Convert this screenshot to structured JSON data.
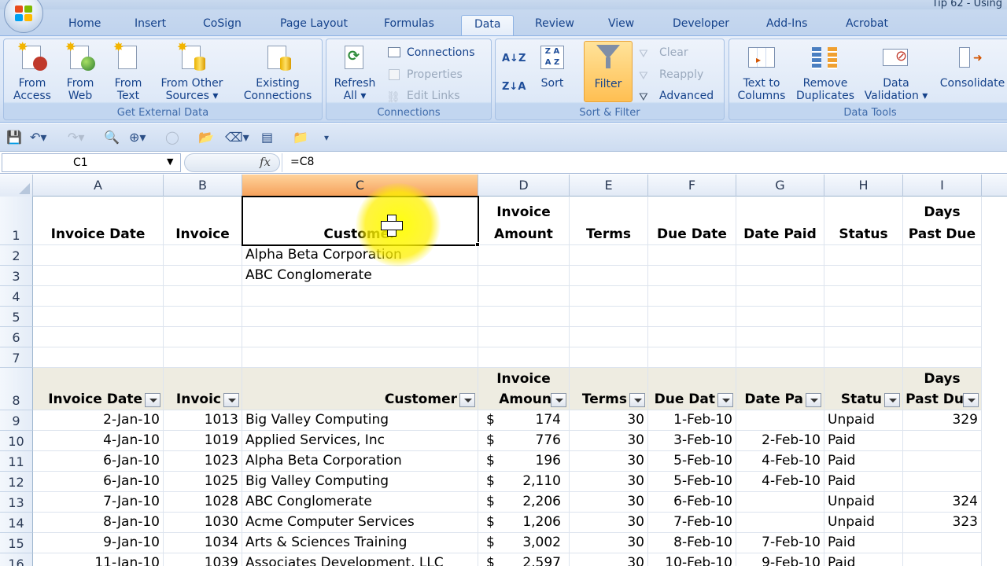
{
  "window": {
    "title": "Tip 62 - Using"
  },
  "ribbon_tabs": [
    "Home",
    "Insert",
    "CoSign",
    "Page Layout",
    "Formulas",
    "Data",
    "Review",
    "View",
    "Developer",
    "Add-Ins",
    "Acrobat"
  ],
  "active_tab": "Data",
  "groups": {
    "get_external": {
      "label": "Get External Data",
      "from_access": [
        "From",
        "Access"
      ],
      "from_web": [
        "From",
        "Web"
      ],
      "from_text": [
        "From",
        "Text"
      ],
      "from_other": [
        "From Other",
        "Sources ▾"
      ],
      "existing": [
        "Existing",
        "Connections"
      ]
    },
    "connections": {
      "label": "Connections",
      "refresh": [
        "Refresh",
        "All ▾"
      ],
      "connections": "Connections",
      "properties": "Properties",
      "edit_links": "Edit Links"
    },
    "sort_filter": {
      "label": "Sort & Filter",
      "sort": "Sort",
      "filter": "Filter",
      "clear": "Clear",
      "reapply": "Reapply",
      "advanced": "Advanced"
    },
    "data_tools": {
      "label": "Data Tools",
      "text_to_columns": [
        "Text to",
        "Columns"
      ],
      "remove_duplicates": [
        "Remove",
        "Duplicates"
      ],
      "data_validation": [
        "Data",
        "Validation ▾"
      ],
      "consolidate": "Consolidate"
    }
  },
  "formula_bar": {
    "name_box": "C1",
    "fx": "fx",
    "formula": "=C8"
  },
  "columns": [
    "A",
    "B",
    "C",
    "D",
    "E",
    "F",
    "G",
    "H",
    "I"
  ],
  "selected_column": "C",
  "rows": [
    "1",
    "2",
    "3",
    "4",
    "5",
    "6",
    "7",
    "8",
    "9",
    "10",
    "11",
    "12",
    "13",
    "14",
    "15",
    "16"
  ],
  "header_row1": {
    "A": "Invoice Date",
    "B": "Invoice",
    "C": "Customer",
    "D": [
      "Invoice",
      "Amount"
    ],
    "E": "Terms",
    "F": "Due Date",
    "G": "Date Paid",
    "H": "Status",
    "I": [
      "Days",
      "Past Due"
    ]
  },
  "criteria": [
    "Alpha Beta Corporation",
    "ABC Conglomerate"
  ],
  "header_row8": {
    "A": "Invoice Date",
    "B": "Invoic",
    "C": "Customer",
    "D": [
      "Invoice",
      "Amoun"
    ],
    "E": "Terms",
    "F": "Due Dat",
    "G": "Date Pa",
    "H": "Statu",
    "I": [
      "Days",
      "Past Du"
    ]
  },
  "table": [
    {
      "date": "2-Jan-10",
      "inv": "1013",
      "cust": "Big Valley Computing",
      "cur": "$",
      "amt": "174",
      "terms": "30",
      "due": "1-Feb-10",
      "paid": "",
      "status": "Unpaid",
      "days": "329"
    },
    {
      "date": "4-Jan-10",
      "inv": "1019",
      "cust": "Applied Services, Inc",
      "cur": "$",
      "amt": "776",
      "terms": "30",
      "due": "3-Feb-10",
      "paid": "2-Feb-10",
      "status": "Paid",
      "days": ""
    },
    {
      "date": "6-Jan-10",
      "inv": "1023",
      "cust": "Alpha Beta Corporation",
      "cur": "$",
      "amt": "196",
      "terms": "30",
      "due": "5-Feb-10",
      "paid": "4-Feb-10",
      "status": "Paid",
      "days": ""
    },
    {
      "date": "6-Jan-10",
      "inv": "1025",
      "cust": "Big Valley Computing",
      "cur": "$",
      "amt": "2,110",
      "terms": "30",
      "due": "5-Feb-10",
      "paid": "4-Feb-10",
      "status": "Paid",
      "days": ""
    },
    {
      "date": "7-Jan-10",
      "inv": "1028",
      "cust": "ABC Conglomerate",
      "cur": "$",
      "amt": "2,206",
      "terms": "30",
      "due": "6-Feb-10",
      "paid": "",
      "status": "Unpaid",
      "days": "324"
    },
    {
      "date": "8-Jan-10",
      "inv": "1030",
      "cust": "Acme Computer Services",
      "cur": "$",
      "amt": "1,206",
      "terms": "30",
      "due": "7-Feb-10",
      "paid": "",
      "status": "Unpaid",
      "days": "323"
    },
    {
      "date": "9-Jan-10",
      "inv": "1034",
      "cust": "Arts & Sciences Training",
      "cur": "$",
      "amt": "3,002",
      "terms": "30",
      "due": "8-Feb-10",
      "paid": "7-Feb-10",
      "status": "Paid",
      "days": ""
    },
    {
      "date": "11-Jan-10",
      "inv": "1039",
      "cust": "Associates Development, LLC",
      "cur": "$",
      "amt": "2,597",
      "terms": "30",
      "due": "10-Feb-10",
      "paid": "9-Feb-10",
      "status": "Paid",
      "days": ""
    }
  ]
}
